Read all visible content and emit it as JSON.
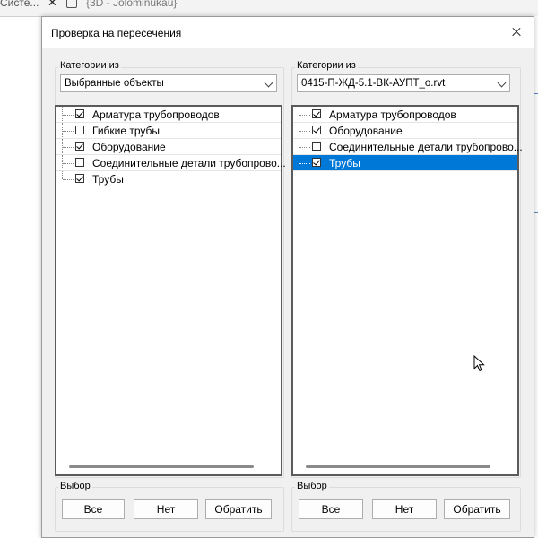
{
  "background": {
    "tab1_title": "Систе...",
    "tab2_title": "{3D - Jolominukau}"
  },
  "dialog": {
    "title": "Проверка на пересечения"
  },
  "left": {
    "categories_label": "Категории из",
    "source_value": "Выбранные объекты",
    "items": [
      {
        "label": "Арматура трубопроводов",
        "checked": true
      },
      {
        "label": "Гибкие трубы",
        "checked": false
      },
      {
        "label": "Оборудование",
        "checked": true
      },
      {
        "label": "Соединительные детали трубопрово...",
        "checked": false
      },
      {
        "label": "Трубы",
        "checked": true
      }
    ],
    "selection_label": "Выбор",
    "btn_all": "Все",
    "btn_none": "Нет",
    "btn_invert": "Обратить"
  },
  "right": {
    "categories_label": "Категории из",
    "source_value": "0415-П-ЖД-5.1-ВК-АУПТ_о.rvt",
    "items": [
      {
        "label": "Арматура трубопроводов",
        "checked": true
      },
      {
        "label": "Оборудование",
        "checked": true
      },
      {
        "label": "Соединительные детали трубопрово...",
        "checked": false
      },
      {
        "label": "Трубы",
        "checked": true,
        "selected": true
      }
    ],
    "selection_label": "Выбор",
    "btn_all": "Все",
    "btn_none": "Нет",
    "btn_invert": "Обратить"
  },
  "icons": {
    "close": "close-icon",
    "dropdown": "chevron-down-icon",
    "cursor": "mouse-pointer-icon"
  }
}
